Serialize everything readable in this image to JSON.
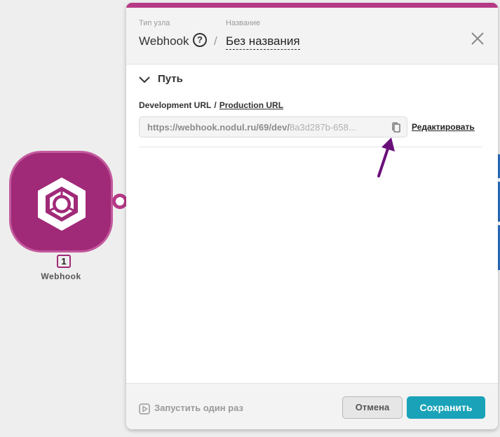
{
  "canvas": {
    "node": {
      "number": "1",
      "label": "Webhook",
      "color": "#a02a78",
      "icon": "webhook-hex-icon"
    }
  },
  "panel": {
    "accent_color": "#b53985",
    "header": {
      "type_caption": "Тип узла",
      "type_value": "Webhook",
      "name_caption": "Название",
      "separator": "/",
      "name_value": "Без названия",
      "help_icon": "help-circle-icon",
      "close_icon": "close-icon"
    },
    "section": {
      "title": "Путь",
      "expanded": true
    },
    "url_tabs": {
      "development_label": "Development URL",
      "separator": "/",
      "production_label": "Production URL",
      "active": "development"
    },
    "url_field": {
      "value_base": "https://webhook.nodul.ru/69/dev/",
      "value_hash": "8a3d287b-658...",
      "copy_icon": "copy-icon"
    },
    "edit_link": "Редактировать",
    "footer": {
      "run_once_label": "Запустить один раз",
      "cancel_label": "Отмена",
      "save_label": "Сохранить",
      "save_color": "#1aa3b8"
    }
  },
  "annotation": {
    "arrow_color": "#6a0f7a",
    "points_to": "copy-icon"
  }
}
